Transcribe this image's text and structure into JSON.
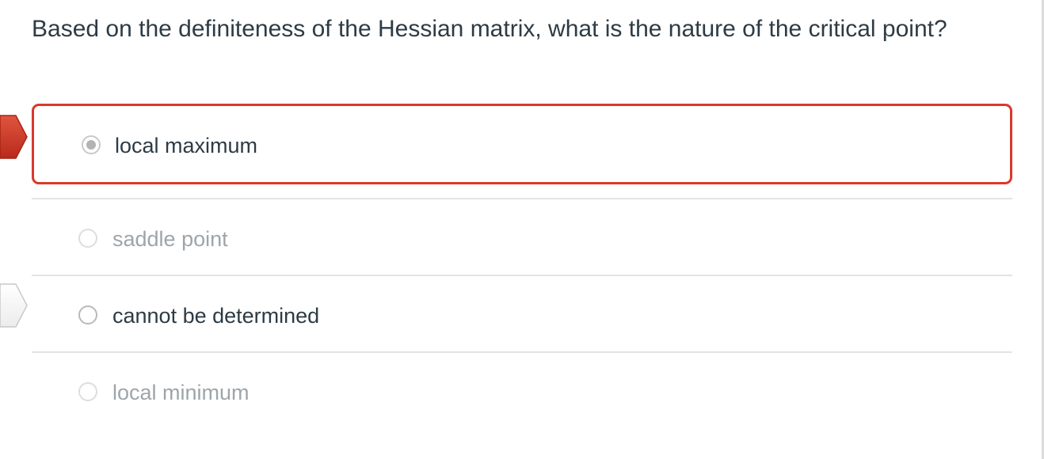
{
  "question": {
    "text": "Based on the definiteness of the Hessian matrix, what is the nature of the critical point?"
  },
  "answers": [
    {
      "label": "local maximum",
      "selected": true,
      "marker": "incorrect-answer-marker"
    },
    {
      "label": "saddle point",
      "selected": false
    },
    {
      "label": "cannot be determined",
      "selected": false,
      "marker": "correct-answer-marker"
    },
    {
      "label": "local minimum",
      "selected": false
    }
  ],
  "colors": {
    "incorrect": "#d9392b",
    "text": "#2d3b45",
    "dim_text": "#9ea5aa",
    "divider": "#e2e4e6"
  },
  "icons": {
    "incorrect_marker": "red-arrow-flag-icon",
    "correct_marker": "white-arrow-flag-icon",
    "radio_selected": "radio-checked-icon",
    "radio_unselected": "radio-unchecked-icon"
  }
}
